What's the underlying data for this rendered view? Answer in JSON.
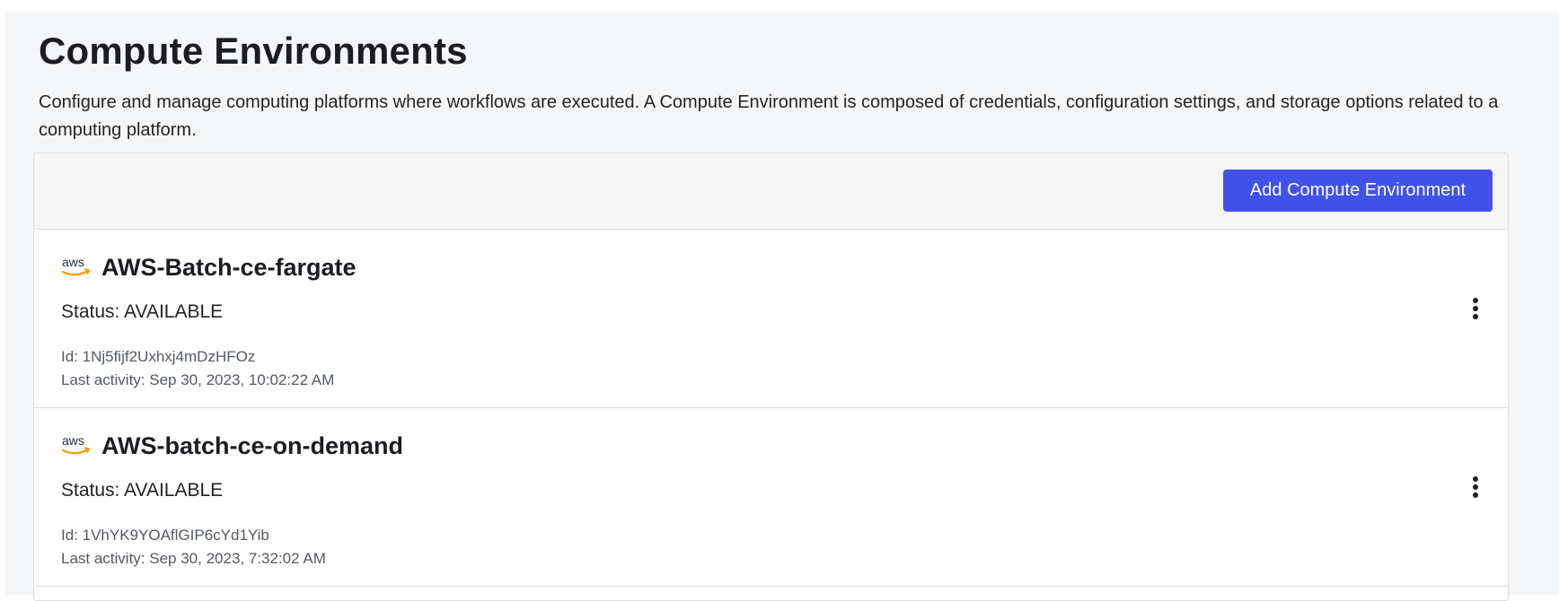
{
  "page": {
    "title": "Compute Environments",
    "description": "Configure and manage computing platforms where workflows are executed. A Compute Environment is composed of credentials, configuration settings, and storage options related to a computing platform."
  },
  "toolbar": {
    "add_label": "Add Compute Environment",
    "accent_color": "#4252e8"
  },
  "environments": [
    {
      "icon": "aws-icon",
      "name": "AWS-Batch-ce-fargate",
      "status": "Status: AVAILABLE",
      "id": "Id: 1Nj5fijf2Uxhxj4mDzHFOz",
      "last_activity": "Last activity: Sep 30, 2023, 10:02:22 AM",
      "menu_icon": "more-vertical-icon"
    },
    {
      "icon": "aws-icon",
      "name": "AWS-batch-ce-on-demand",
      "status": "Status: AVAILABLE",
      "id": "Id: 1VhYK9YOAflGIP6cYd1Yib",
      "last_activity": "Last activity: Sep 30, 2023, 7:32:02 AM",
      "menu_icon": "more-vertical-icon"
    }
  ]
}
